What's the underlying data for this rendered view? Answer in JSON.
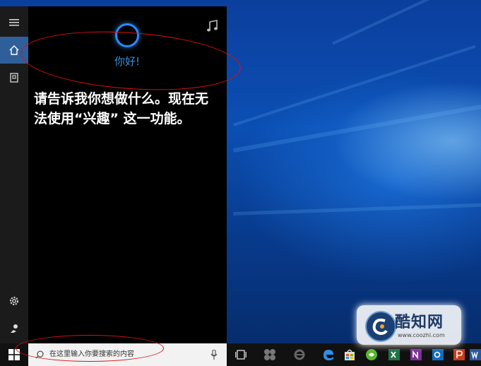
{
  "cortana": {
    "greeting": "你好!",
    "message": "请告诉我你想做什么。现在无法使用“兴趣” 这一功能。",
    "accent_color": "#2a8cff"
  },
  "rail": {
    "items": [
      {
        "icon": "hamburger-menu-icon"
      },
      {
        "icon": "home-icon",
        "active": true
      },
      {
        "icon": "notebook-icon"
      },
      {
        "icon": "gear-icon"
      },
      {
        "icon": "feedback-icon"
      }
    ]
  },
  "taskbar": {
    "search_placeholder": "在这里输入你要搜索的内容",
    "icons": [
      "windows-start-icon",
      "microphone-icon",
      "task-view-icon",
      "app-icon",
      "ie-icon",
      "edge-icon",
      "store-icon",
      "browser-icon",
      "excel-icon",
      "onenote-icon",
      "outlook-icon",
      "powerpoint-icon",
      "word-icon"
    ]
  },
  "watermark": {
    "brand": "酷知网",
    "url": "www.coozhi.com"
  }
}
